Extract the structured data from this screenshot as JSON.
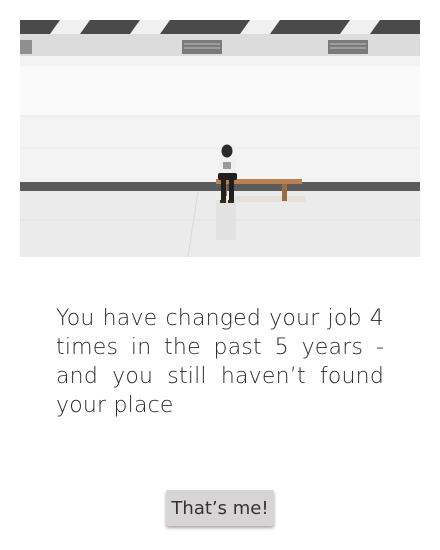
{
  "hero": {
    "image_description_icon": "photo-person-on-bench-icon"
  },
  "message": {
    "text": "You have changed your job 4 times in the past 5 years - and you still haven’t found your place"
  },
  "cta": {
    "label": "That’s me!"
  },
  "colors": {
    "button_bg": "#d6d4d4",
    "text": "#2a2a2a"
  }
}
